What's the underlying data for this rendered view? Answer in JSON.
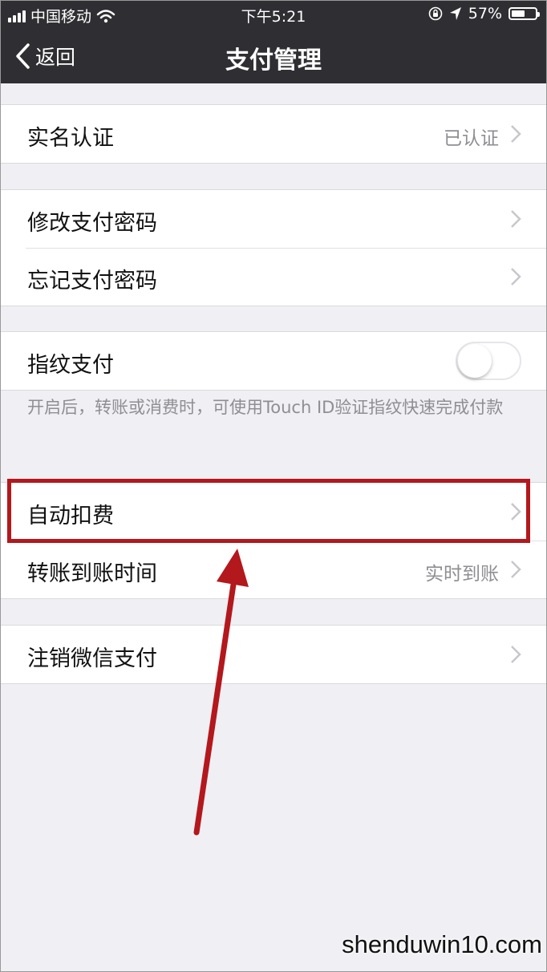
{
  "status_bar": {
    "carrier": "中国移动",
    "time": "下午5:21",
    "battery_text": "57%",
    "battery_level": 0.57
  },
  "nav": {
    "back_label": "返回",
    "title": "支付管理"
  },
  "groups": [
    {
      "rows": [
        {
          "label": "实名认证",
          "value": "已认证",
          "chevron": true
        }
      ]
    },
    {
      "rows": [
        {
          "label": "修改支付密码",
          "chevron": true
        },
        {
          "label": "忘记支付密码",
          "chevron": true
        }
      ]
    },
    {
      "rows": [
        {
          "label": "指纹支付",
          "toggle_on": false
        }
      ]
    },
    {
      "rows": [
        {
          "label": "自动扣费",
          "chevron": true
        },
        {
          "label": "转账到账时间",
          "value": "实时到账",
          "chevron": true
        }
      ]
    },
    {
      "rows": [
        {
          "label": "注销微信支付",
          "chevron": true
        }
      ]
    }
  ],
  "fingerprint_note": "开启后，转账或消费时，可使用Touch ID验证指纹快速完成付款",
  "annotation": {
    "highlight_color": "#b3181c",
    "arrow_color": "#b3181c"
  },
  "watermark": "shenduwin10.com",
  "colors": {
    "nav_bg": "#2f2f33",
    "page_bg": "#efeff4",
    "secondary_text": "#8e8e93"
  }
}
